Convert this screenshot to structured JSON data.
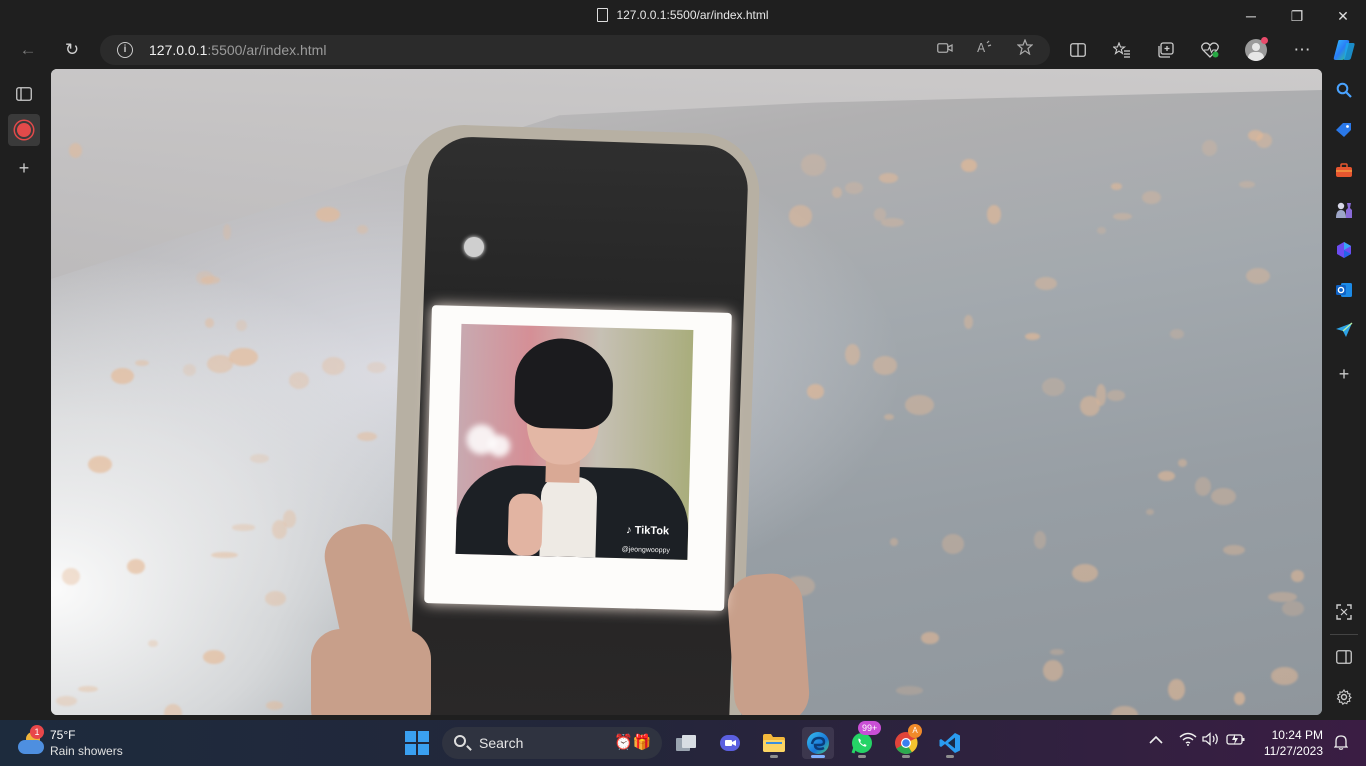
{
  "window": {
    "title": "127.0.0.1:5500/ar/index.html",
    "minimize": "─",
    "restore": "❐",
    "close": "✕"
  },
  "toolbar": {
    "back": "←",
    "refresh": "↻",
    "url_host": "127.0.0.1",
    "url_path": ":5500/ar/index.html",
    "info": "i",
    "more": "⋯"
  },
  "left_sidebar": {
    "tab_actions": "▭",
    "add": "+"
  },
  "right_sidebar": {
    "add": "+"
  },
  "content": {
    "overlay_brand": "TikTok",
    "overlay_handle": "@jeongwooppy"
  },
  "taskbar": {
    "weather": {
      "badge": "1",
      "temperature": "75°F",
      "condition": "Rain showers"
    },
    "search_label": "Search",
    "whatsapp_badge": "99+",
    "chrome_badge": "A",
    "time": "10:24 PM",
    "date": "11/27/2023"
  },
  "colors": {
    "record_red": "#e24a4a",
    "taskbar_start": "#1d2b3d",
    "taskbar_end": "#3a1d43",
    "windows_blue": "#3aa0f0"
  }
}
